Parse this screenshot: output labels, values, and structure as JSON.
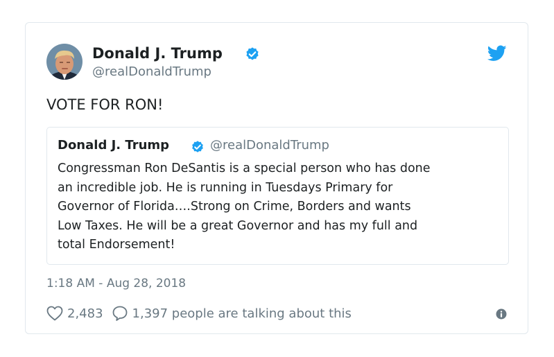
{
  "tweet": {
    "author_name": "Donald J. Trump",
    "author_handle": "@realDonaldTrump",
    "text": "VOTE FOR RON!",
    "timestamp": "1:18 AM - Aug 28, 2018",
    "likes": "2,483",
    "talking": "1,397 people are talking about this"
  },
  "quoted": {
    "author_name": "Donald J. Trump",
    "author_handle": "@realDonaldTrump",
    "lines": [
      "Congressman Ron DeSantis is a special person who has done",
      "an incredible job. He is running in Tuesdays Primary for",
      "Governor of Florida….Strong on Crime, Borders and wants",
      "Low Taxes. He will be a great Governor and has my full and",
      "total Endorsement!"
    ]
  },
  "icons": {
    "verified": "verified-badge-icon",
    "brand": "twitter-bird-icon",
    "like": "heart-icon",
    "reply": "speech-bubble-icon",
    "info": "info-icon"
  },
  "colors": {
    "brand_blue": "#1da1f2",
    "text": "#1c2022",
    "muted": "#697882",
    "border": "#e1e8ed"
  }
}
